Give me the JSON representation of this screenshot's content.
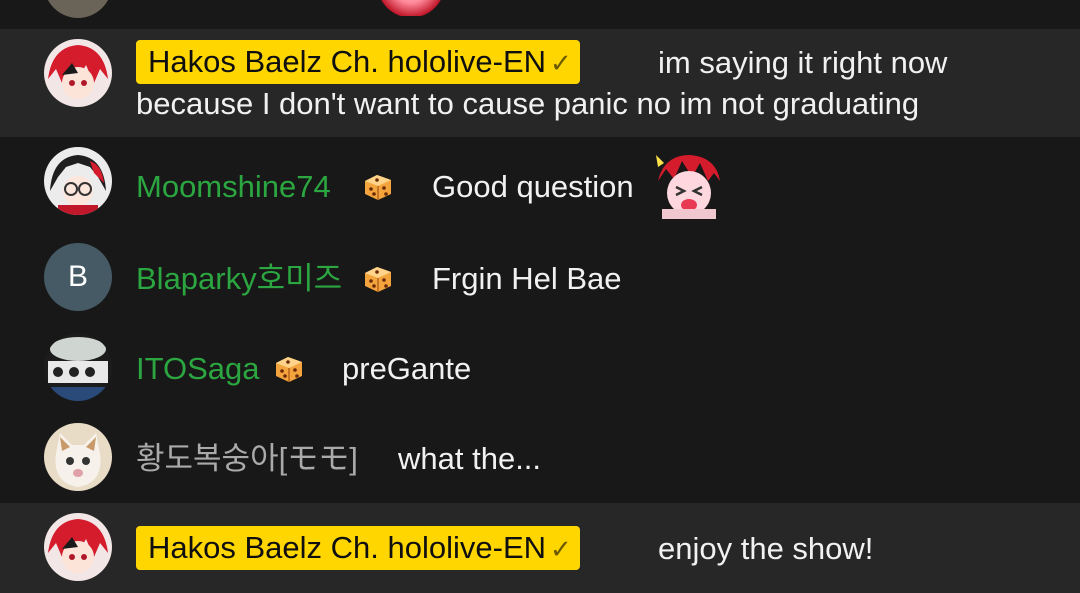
{
  "messages": [
    {
      "author": "Hakos Baelz Ch. hololive-EN",
      "role": "owner",
      "verified_mark": "✓",
      "line1": "im saying it right now",
      "line2": "because I don't want to cause panic no im not graduating"
    },
    {
      "author": "Moomshine74",
      "role": "member",
      "badge": "dice-badge-icon",
      "text": "Good question",
      "emoji": "bae-panic-emote-icon"
    },
    {
      "author": "Blaparky호미즈",
      "role": "member",
      "badge": "dice-badge-icon",
      "avatar_letter": "B",
      "text": "Frgin Hel Bae"
    },
    {
      "author": "ITOSaga",
      "role": "member",
      "badge": "dice-badge-icon",
      "text": "preGante"
    },
    {
      "author": "황도복숭아[モモ]",
      "role": "viewer",
      "text": "what the..."
    },
    {
      "author": "Hakos Baelz Ch. hololive-EN",
      "role": "owner",
      "verified_mark": "✓",
      "text": "enjoy the show!"
    }
  ],
  "colors": {
    "owner_badge": "#ffd600",
    "member_name": "#2ba640",
    "viewer_name": "#aaaaaa",
    "owner_row_bg": "#272727",
    "bg": "#181818"
  }
}
